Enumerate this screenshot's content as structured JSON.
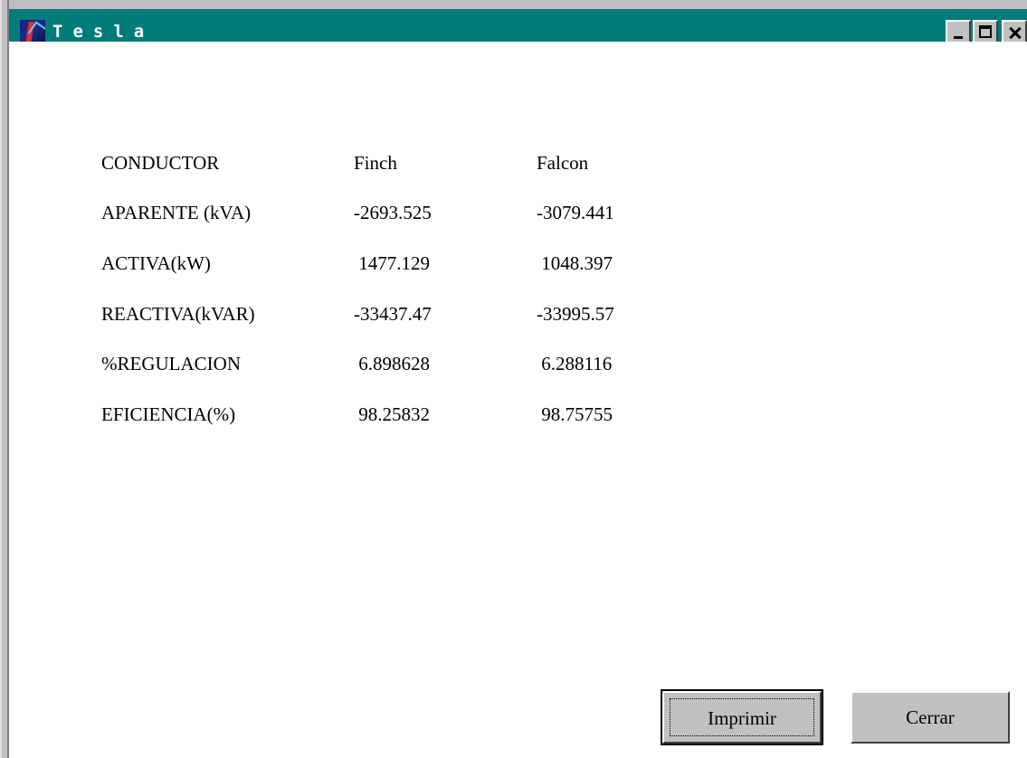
{
  "window": {
    "title": "Tesla",
    "app_icon": "tesla-app-icon",
    "controls": [
      "minimize-icon",
      "maximize-icon",
      "close-icon"
    ]
  },
  "results": {
    "headers": {
      "label": "CONDUCTOR",
      "col1": "Finch",
      "col2": "Falcon"
    },
    "rows": [
      {
        "label": "APARENTE (kVA)",
        "col1": "-2693.525",
        "col2": "-3079.441"
      },
      {
        "label": "ACTIVA(kW)",
        "col1": " 1477.129",
        "col2": " 1048.397"
      },
      {
        "label": "REACTIVA(kVAR)",
        "col1": "-33437.47",
        "col2": "-33995.57"
      },
      {
        "label": "%REGULACION",
        "col1": " 6.898628",
        "col2": " 6.288116"
      },
      {
        "label": "EFICIENCIA(%)",
        "col1": " 98.25832",
        "col2": " 98.75755"
      }
    ]
  },
  "buttons": {
    "print": "Imprimir",
    "close": "Cerrar"
  },
  "colors": {
    "title_bar": "#007b7b",
    "button_face": "#c0c0c0",
    "client_background": "#ffffff"
  }
}
